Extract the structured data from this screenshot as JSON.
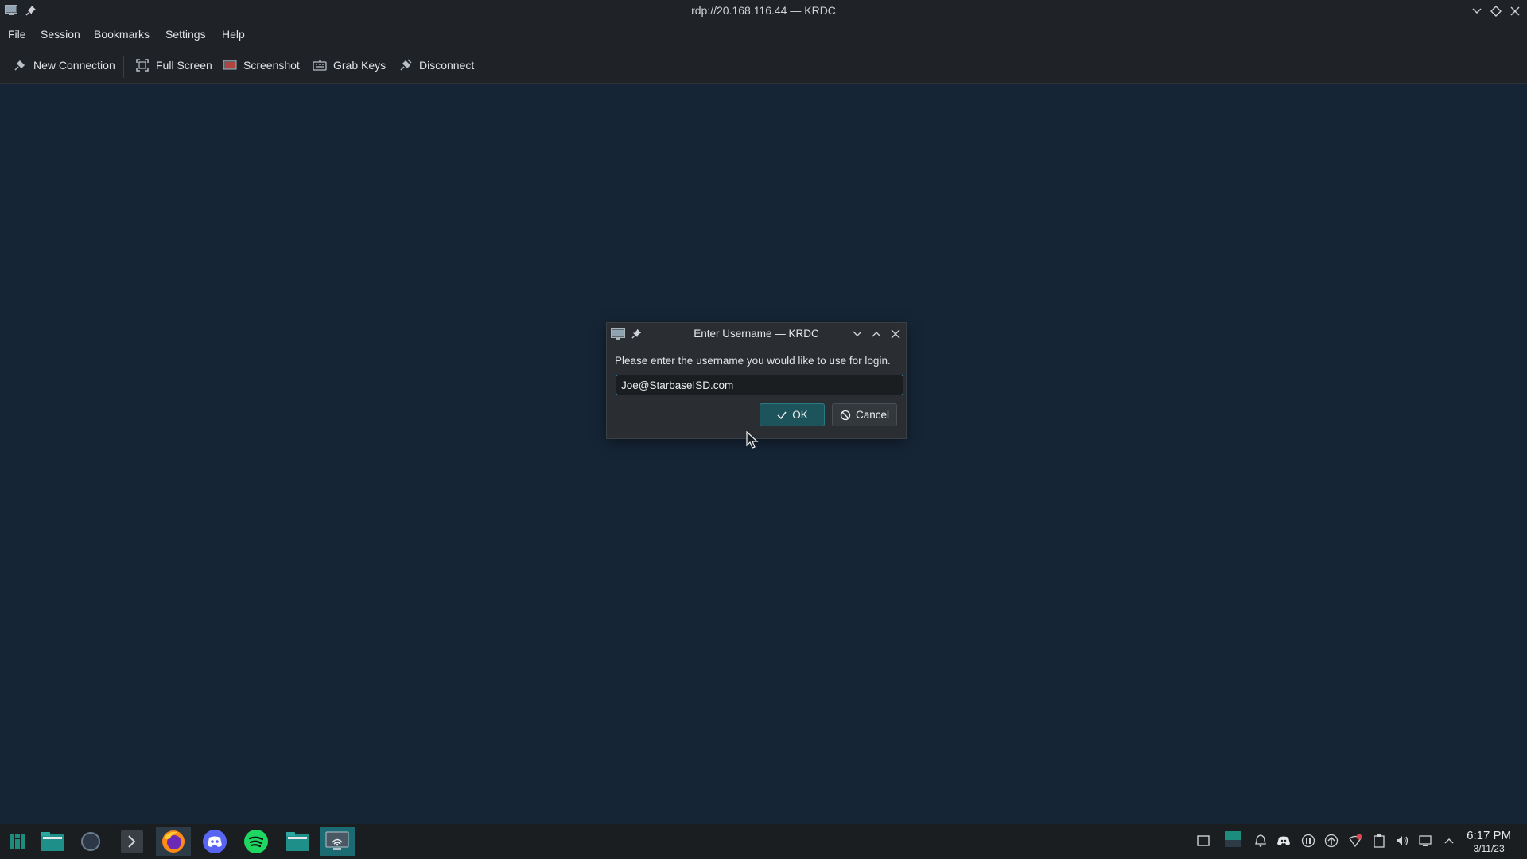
{
  "window": {
    "title": "rdp://20.168.116.44 — KRDC"
  },
  "menubar": {
    "items": [
      "File",
      "Session",
      "Bookmarks",
      "Settings",
      "Help"
    ]
  },
  "toolbar": {
    "new_connection": "New Connection",
    "full_screen": "Full Screen",
    "screenshot": "Screenshot",
    "grab_keys": "Grab Keys",
    "disconnect": "Disconnect"
  },
  "dialog": {
    "title": "Enter Username — KRDC",
    "prompt": "Please enter the username you would like to use for login.",
    "username_value": "Joe@StarbaseISD.com",
    "ok_label": "OK",
    "cancel_label": "Cancel"
  },
  "taskbar": {
    "apps": [
      "application-launcher-icon",
      "file-manager-icon",
      "circle-app-icon",
      "terminal-icon",
      "firefox-icon",
      "discord-icon",
      "spotify-icon",
      "folder-icon",
      "krdc-icon"
    ]
  },
  "clock": {
    "time": "6:17 PM",
    "date": "3/11/23"
  },
  "colors": {
    "background": "#162536",
    "accent": "#3daee9",
    "ok_button": "#1d545c"
  }
}
